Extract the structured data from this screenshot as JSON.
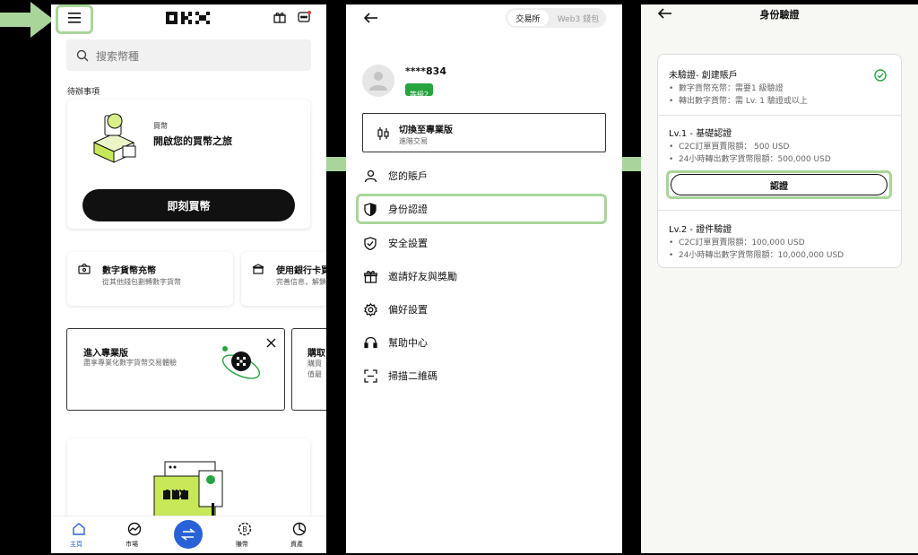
{
  "colors": {
    "highlight": "#a9d59a",
    "accent_green": "#27a33f",
    "dark": "#111111",
    "nav_blue": "#2962d6"
  },
  "screen1": {
    "logo": "OKX",
    "search_placeholder": "搜索幣種",
    "todo_heading": "待辦事項",
    "buy_card": {
      "small_label": "買幣",
      "title": "開啟您的買幣之旅",
      "button": "即刻買幣"
    },
    "quick": [
      {
        "title": "數字貨幣充幣",
        "subtitle": "從其他錢包劃轉數字貨幣"
      },
      {
        "title": "使用銀行卡買",
        "subtitle": "完善信息，解鎖"
      }
    ],
    "promo": {
      "title": "進入專業版",
      "subtitle": "盡享專業化數字貨幣交易體驗"
    },
    "promo2": {
      "title": "購取",
      "line1": "購買",
      "line2": "值最"
    },
    "illustration_logo": "OKX",
    "bottom_nav": [
      {
        "label": "主頁",
        "icon": "home-icon"
      },
      {
        "label": "市場",
        "icon": "market-icon"
      },
      {
        "label": "",
        "icon": "trade-icon"
      },
      {
        "label": "賺幣",
        "icon": "earn-icon"
      },
      {
        "label": "資產",
        "icon": "assets-icon"
      }
    ]
  },
  "screen2": {
    "tabs": [
      "交易所",
      "Web3 錢包"
    ],
    "user_id": "****834",
    "level_badge": "等級2",
    "switch_pro": {
      "title": "切換至專業版",
      "subtitle": "進階交易"
    },
    "menu": [
      {
        "label": "您的賬戶",
        "icon": "user-icon"
      },
      {
        "label": "身份認證",
        "icon": "shield-filled-icon"
      },
      {
        "label": "安全設置",
        "icon": "shield-check-icon"
      },
      {
        "label": "邀請好友與獎勵",
        "icon": "gift-icon"
      },
      {
        "label": "偏好設置",
        "icon": "gear-icon"
      },
      {
        "label": "幫助中心",
        "icon": "headset-icon"
      },
      {
        "label": "掃描二維碼",
        "icon": "scan-icon"
      }
    ]
  },
  "screen3": {
    "title": "身份驗證",
    "unverified": {
      "title": "未驗證- 創建賬戶",
      "lines": [
        "數字貨幣充幣：需要1 級驗證",
        "轉出數字貨幣：需 Lv. 1 驗證或以上"
      ]
    },
    "lv1": {
      "title": "Lv.1 - 基礎認證",
      "lines": [
        "C2C訂單買賣限額： 500 USD",
        "24小時轉出數字貨幣限額：500,000 USD"
      ],
      "button": "認證"
    },
    "lv2": {
      "title": "Lv.2 - 證件驗證",
      "lines": [
        "C2C訂單買賣限額：100,000 USD",
        "24小時轉出數字貨幣限額：10,000,000 USD"
      ]
    }
  }
}
